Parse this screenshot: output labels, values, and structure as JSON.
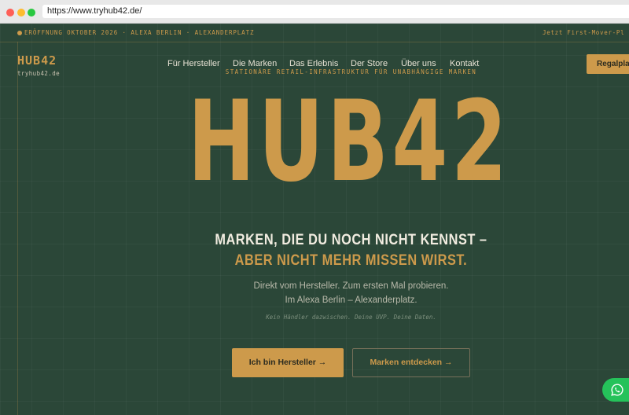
{
  "browser": {
    "url": "https://www.tryhub42.de/"
  },
  "topbar": {
    "announcement": "ERÖFFNUNG OKTOBER 2026 · ALEXA BERLIN · ALEXANDERPLATZ",
    "right_text": "Jetzt First-Mover-Pl"
  },
  "brand": {
    "logo": "HUB42",
    "domain": "tryhub42.de"
  },
  "nav": {
    "items": [
      "Für Hersteller",
      "Die Marken",
      "Das Erlebnis",
      "Der Store",
      "Über uns",
      "Kontakt"
    ],
    "cta": "Regalpla"
  },
  "hero": {
    "tagline": "STATIONÄRE RETAIL-INFRASTRUKTUR FÜR UNABHÄNGIGE MARKEN",
    "title": "HUB42",
    "headline_1": "MARKEN, DIE DU NOCH NICHT KENNST –",
    "headline_2": "ABER NICHT MEHR MISSEN WIRST.",
    "desc_1": "Direkt vom Hersteller. Zum ersten Mal probieren.",
    "desc_2": "Im Alexa Berlin – Alexanderplatz.",
    "note": "Kein Händler dazwischen. Deine UVP. Deine Daten.",
    "btn_primary": "Ich bin Hersteller →",
    "btn_secondary": "Marken entdecken →"
  },
  "icons": {
    "whatsapp": "whatsapp-icon"
  },
  "colors": {
    "background": "#2b4738",
    "accent": "#cd9a4b",
    "whatsapp": "#25c25a"
  }
}
